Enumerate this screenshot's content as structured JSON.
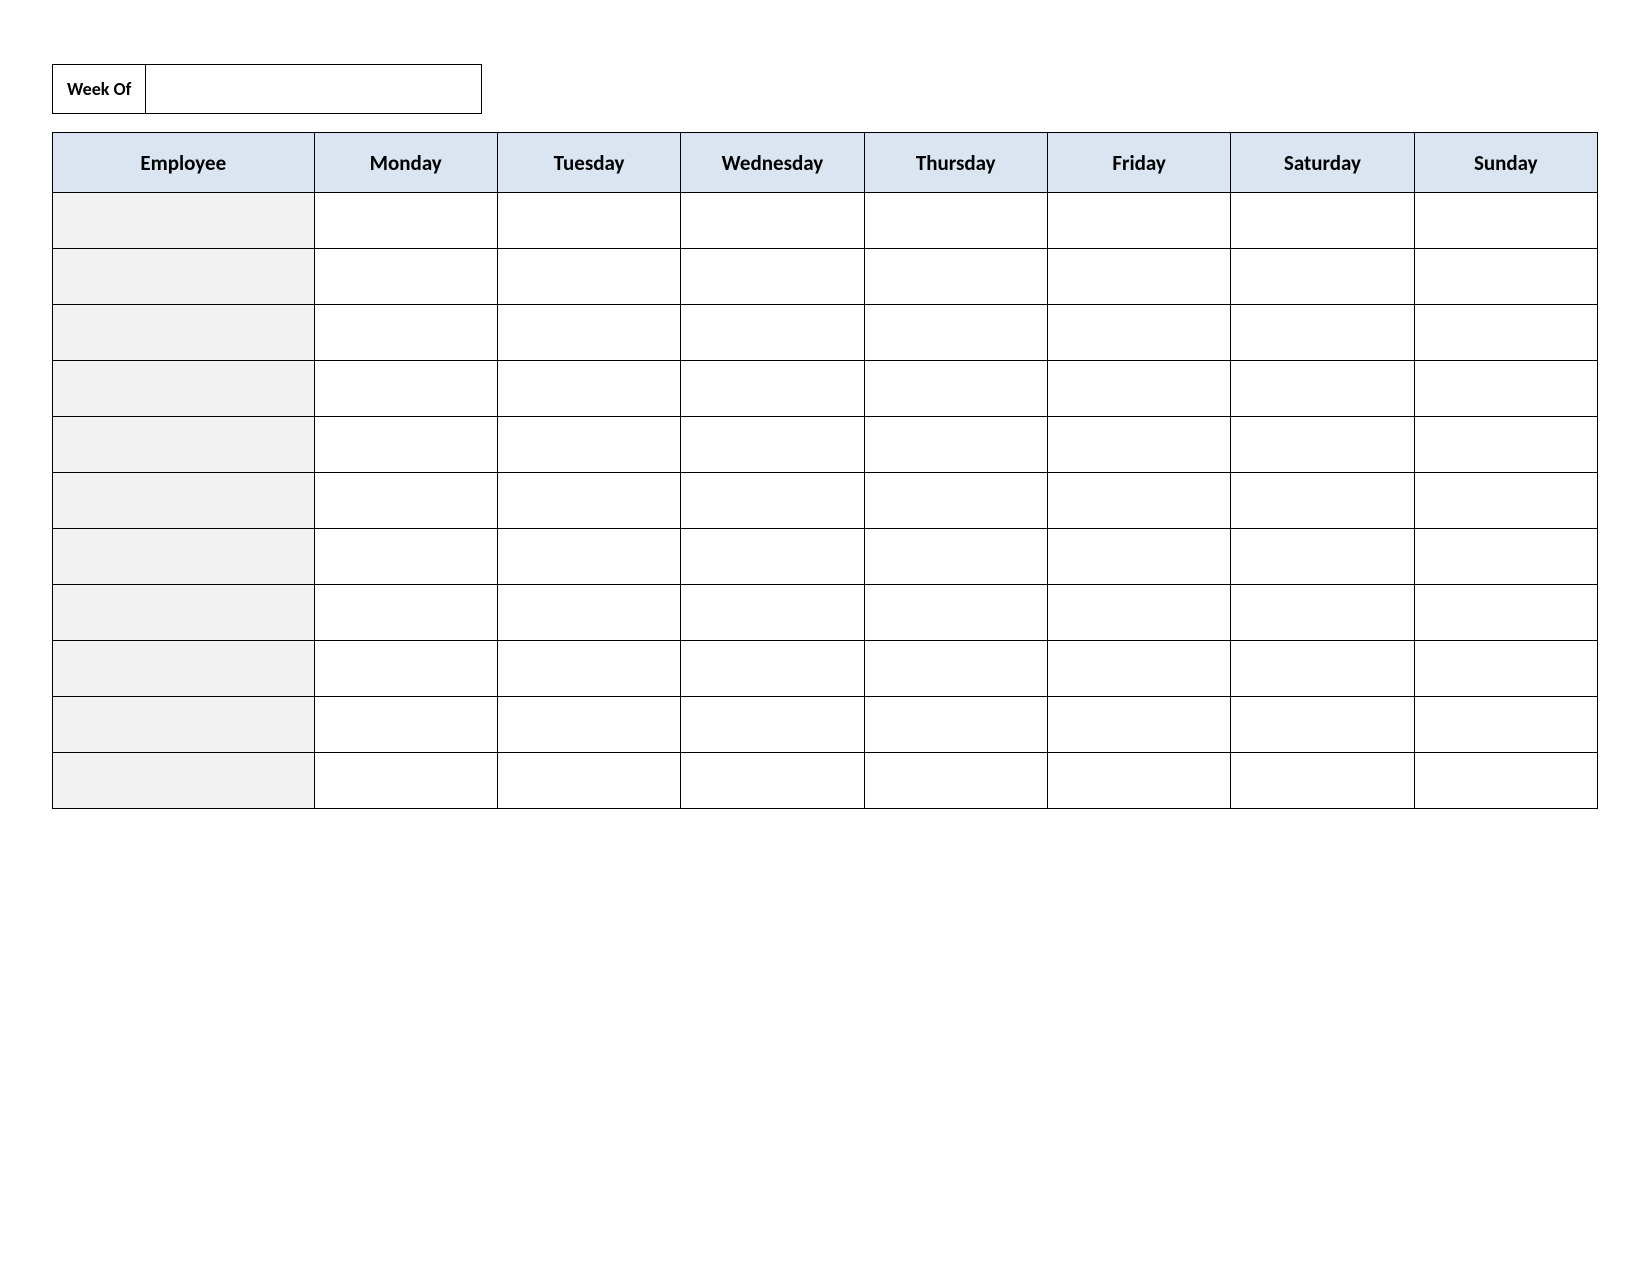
{
  "week_of": {
    "label": "Week Of",
    "value": ""
  },
  "headers": {
    "employee": "Employee",
    "days": [
      "Monday",
      "Tuesday",
      "Wednesday",
      "Thursday",
      "Friday",
      "Saturday",
      "Sunday"
    ]
  },
  "rows": [
    {
      "employee": "",
      "cells": [
        "",
        "",
        "",
        "",
        "",
        "",
        ""
      ]
    },
    {
      "employee": "",
      "cells": [
        "",
        "",
        "",
        "",
        "",
        "",
        ""
      ]
    },
    {
      "employee": "",
      "cells": [
        "",
        "",
        "",
        "",
        "",
        "",
        ""
      ]
    },
    {
      "employee": "",
      "cells": [
        "",
        "",
        "",
        "",
        "",
        "",
        ""
      ]
    },
    {
      "employee": "",
      "cells": [
        "",
        "",
        "",
        "",
        "",
        "",
        ""
      ]
    },
    {
      "employee": "",
      "cells": [
        "",
        "",
        "",
        "",
        "",
        "",
        ""
      ]
    },
    {
      "employee": "",
      "cells": [
        "",
        "",
        "",
        "",
        "",
        "",
        ""
      ]
    },
    {
      "employee": "",
      "cells": [
        "",
        "",
        "",
        "",
        "",
        "",
        ""
      ]
    },
    {
      "employee": "",
      "cells": [
        "",
        "",
        "",
        "",
        "",
        "",
        ""
      ]
    },
    {
      "employee": "",
      "cells": [
        "",
        "",
        "",
        "",
        "",
        "",
        ""
      ]
    },
    {
      "employee": "",
      "cells": [
        "",
        "",
        "",
        "",
        "",
        "",
        ""
      ]
    }
  ]
}
